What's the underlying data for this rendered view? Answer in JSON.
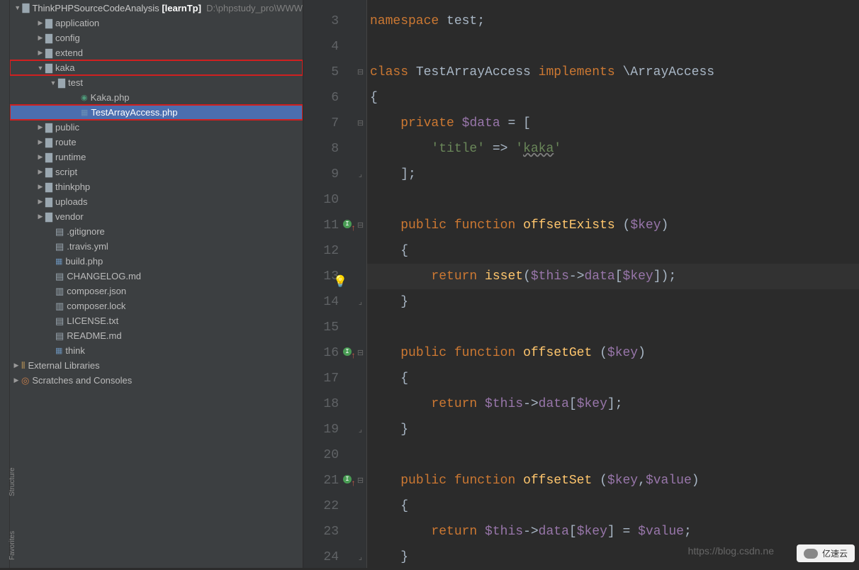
{
  "leftRail": {
    "structure": "Structure",
    "favorites": "Favorites"
  },
  "project": {
    "root": {
      "name": "ThinkPHPSourceCodeAnalysis",
      "module": "[learnTp]",
      "path": "D:\\phpstudy_pro\\WWW"
    },
    "items": [
      {
        "label": "application",
        "indent": 36,
        "arrow": "▶",
        "icon": "folder"
      },
      {
        "label": "config",
        "indent": 36,
        "arrow": "▶",
        "icon": "folder"
      },
      {
        "label": "extend",
        "indent": 36,
        "arrow": "▶",
        "icon": "folder"
      },
      {
        "label": "kaka",
        "indent": 36,
        "arrow": "▼",
        "icon": "folder",
        "hl": true
      },
      {
        "label": "test",
        "indent": 54,
        "arrow": "▼",
        "icon": "folder"
      },
      {
        "label": "Kaka.php",
        "indent": 86,
        "arrow": "",
        "icon": "php-c"
      },
      {
        "label": "TestArrayAccess.php",
        "indent": 86,
        "arrow": "",
        "icon": "php",
        "sel": true,
        "hl": true
      },
      {
        "label": "public",
        "indent": 36,
        "arrow": "▶",
        "icon": "folder"
      },
      {
        "label": "route",
        "indent": 36,
        "arrow": "▶",
        "icon": "folder"
      },
      {
        "label": "runtime",
        "indent": 36,
        "arrow": "▶",
        "icon": "folder"
      },
      {
        "label": "script",
        "indent": 36,
        "arrow": "▶",
        "icon": "folder"
      },
      {
        "label": "thinkphp",
        "indent": 36,
        "arrow": "▶",
        "icon": "folder"
      },
      {
        "label": "uploads",
        "indent": 36,
        "arrow": "▶",
        "icon": "folder"
      },
      {
        "label": "vendor",
        "indent": 36,
        "arrow": "▶",
        "icon": "folder"
      },
      {
        "label": ".gitignore",
        "indent": 50,
        "arrow": "",
        "icon": "file"
      },
      {
        "label": ".travis.yml",
        "indent": 50,
        "arrow": "",
        "icon": "file"
      },
      {
        "label": "build.php",
        "indent": 50,
        "arrow": "",
        "icon": "php"
      },
      {
        "label": "CHANGELOG.md",
        "indent": 50,
        "arrow": "",
        "icon": "file"
      },
      {
        "label": "composer.json",
        "indent": 50,
        "arrow": "",
        "icon": "json"
      },
      {
        "label": "composer.lock",
        "indent": 50,
        "arrow": "",
        "icon": "json"
      },
      {
        "label": "LICENSE.txt",
        "indent": 50,
        "arrow": "",
        "icon": "file"
      },
      {
        "label": "README.md",
        "indent": 50,
        "arrow": "",
        "icon": "file"
      },
      {
        "label": "think",
        "indent": 50,
        "arrow": "",
        "icon": "php"
      }
    ],
    "extLib": "External Libraries",
    "scratches": "Scratches and Consoles"
  },
  "code": {
    "lines": [
      {
        "n": 3,
        "tok": [
          [
            "kw",
            "namespace "
          ],
          [
            "ns",
            "test"
          ],
          [
            "txt",
            ";"
          ]
        ]
      },
      {
        "n": 4,
        "tok": []
      },
      {
        "n": 5,
        "fold": "⊟",
        "tok": [
          [
            "kw",
            "class "
          ],
          [
            "type",
            "TestArrayAccess "
          ],
          [
            "kw",
            "implements "
          ],
          [
            "type",
            "\\ArrayAccess"
          ]
        ]
      },
      {
        "n": 6,
        "tok": [
          [
            "txt",
            "{"
          ]
        ]
      },
      {
        "n": 7,
        "fold": "⊟",
        "tok": [
          [
            "txt",
            "    "
          ],
          [
            "kw",
            "private "
          ],
          [
            "var",
            "$data"
          ],
          [
            "txt",
            " = ["
          ]
        ]
      },
      {
        "n": 8,
        "tok": [
          [
            "txt",
            "        "
          ],
          [
            "str",
            "'title'"
          ],
          [
            "txt",
            " => "
          ],
          [
            "str",
            "'"
          ],
          [
            "strU",
            "kaka"
          ],
          [
            "str",
            "'"
          ]
        ]
      },
      {
        "n": 9,
        "fold": "⊟b",
        "tok": [
          [
            "txt",
            "    ];"
          ]
        ]
      },
      {
        "n": 10,
        "tok": []
      },
      {
        "n": 11,
        "impl": true,
        "fold": "⊟",
        "tok": [
          [
            "txt",
            "    "
          ],
          [
            "kw",
            "public "
          ],
          [
            "kw",
            "function "
          ],
          [
            "fn",
            "offsetExists "
          ],
          [
            "txt",
            "("
          ],
          [
            "var",
            "$key"
          ],
          [
            "txt",
            ")"
          ]
        ]
      },
      {
        "n": 12,
        "tok": [
          [
            "txt",
            "    {"
          ]
        ]
      },
      {
        "n": 13,
        "hl": true,
        "bulb": true,
        "tok": [
          [
            "txt",
            "        "
          ],
          [
            "kw",
            "return "
          ],
          [
            "fn",
            "isset"
          ],
          [
            "txt",
            "("
          ],
          [
            "var",
            "$this"
          ],
          [
            "op",
            "->"
          ],
          [
            "var",
            "data"
          ],
          [
            "txt",
            "["
          ],
          [
            "var",
            "$key"
          ],
          [
            "txt",
            "]);"
          ]
        ]
      },
      {
        "n": 14,
        "fold": "⊟b",
        "tok": [
          [
            "txt",
            "    }"
          ]
        ]
      },
      {
        "n": 15,
        "tok": []
      },
      {
        "n": 16,
        "impl": true,
        "fold": "⊟",
        "tok": [
          [
            "txt",
            "    "
          ],
          [
            "kw",
            "public "
          ],
          [
            "kw",
            "function "
          ],
          [
            "fn",
            "offsetGet "
          ],
          [
            "txt",
            "("
          ],
          [
            "var",
            "$key"
          ],
          [
            "txt",
            ")"
          ]
        ]
      },
      {
        "n": 17,
        "tok": [
          [
            "txt",
            "    {"
          ]
        ]
      },
      {
        "n": 18,
        "tok": [
          [
            "txt",
            "        "
          ],
          [
            "kw",
            "return "
          ],
          [
            "var",
            "$this"
          ],
          [
            "op",
            "->"
          ],
          [
            "var",
            "data"
          ],
          [
            "txt",
            "["
          ],
          [
            "var",
            "$key"
          ],
          [
            "txt",
            "];"
          ]
        ]
      },
      {
        "n": 19,
        "fold": "⊟b",
        "tok": [
          [
            "txt",
            "    }"
          ]
        ]
      },
      {
        "n": 20,
        "tok": []
      },
      {
        "n": 21,
        "impl": true,
        "fold": "⊟",
        "tok": [
          [
            "txt",
            "    "
          ],
          [
            "kw",
            "public "
          ],
          [
            "kw",
            "function "
          ],
          [
            "fn",
            "offsetSet "
          ],
          [
            "txt",
            "("
          ],
          [
            "var",
            "$key"
          ],
          [
            "txt",
            ","
          ],
          [
            "var",
            "$value"
          ],
          [
            "txt",
            ")"
          ]
        ]
      },
      {
        "n": 22,
        "tok": [
          [
            "txt",
            "    {"
          ]
        ]
      },
      {
        "n": 23,
        "tok": [
          [
            "txt",
            "        "
          ],
          [
            "kw",
            "return "
          ],
          [
            "var",
            "$this"
          ],
          [
            "op",
            "->"
          ],
          [
            "var",
            "data"
          ],
          [
            "txt",
            "["
          ],
          [
            "var",
            "$key"
          ],
          [
            "txt",
            "] = "
          ],
          [
            "var",
            "$value"
          ],
          [
            "txt",
            ";"
          ]
        ]
      },
      {
        "n": 24,
        "fold": "⊟b",
        "tok": [
          [
            "txt",
            "    }"
          ]
        ]
      }
    ]
  },
  "watermark1": "https://blog.csdn.ne",
  "watermark2": "亿速云"
}
